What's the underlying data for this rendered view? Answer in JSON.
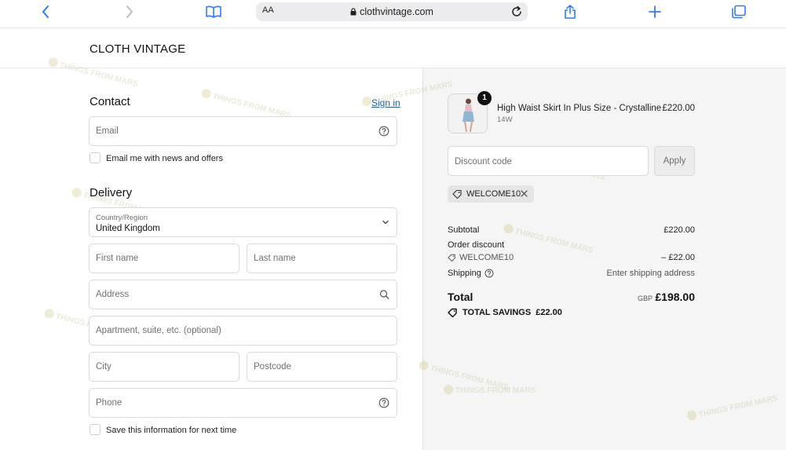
{
  "browser": {
    "text_size_label": "AA",
    "url": "clothvintage.com"
  },
  "store": {
    "brand": "CLOTH VINTAGE"
  },
  "contact": {
    "title": "Contact",
    "sign_in": "Sign in",
    "email_placeholder": "Email",
    "newsletter_label": "Email me with news and offers"
  },
  "delivery": {
    "title": "Delivery",
    "country_label": "Country/Region",
    "country_value": "United Kingdom",
    "first_name_placeholder": "First name",
    "last_name_placeholder": "Last name",
    "address_placeholder": "Address",
    "apartment_placeholder": "Apartment, suite, etc. (optional)",
    "city_placeholder": "City",
    "postcode_placeholder": "Postcode",
    "phone_placeholder": "Phone",
    "save_info_label": "Save this information for next time"
  },
  "summary": {
    "product": {
      "quantity": "1",
      "name": "High Waist Skirt In Plus Size - Crystalline",
      "variant": "14W",
      "price": "£220.00"
    },
    "discount_placeholder": "Discount code",
    "apply_label": "Apply",
    "applied_code": "WELCOME10",
    "subtotal_label": "Subtotal",
    "subtotal_value": "£220.00",
    "order_discount_label": "Order discount",
    "order_discount_code": "WELCOME10",
    "order_discount_value": "– £22.00",
    "shipping_label": "Shipping",
    "shipping_value": "Enter shipping address",
    "total_label": "Total",
    "total_currency": "GBP",
    "total_value": "£198.00",
    "savings_label": "TOTAL SAVINGS",
    "savings_value": "£22.00"
  },
  "watermark": {
    "text": "THINGS FROM MARS"
  },
  "colors": {
    "link": "#1f5fa8",
    "summary_bg": "#f5f5f5",
    "badge": "#111111"
  }
}
